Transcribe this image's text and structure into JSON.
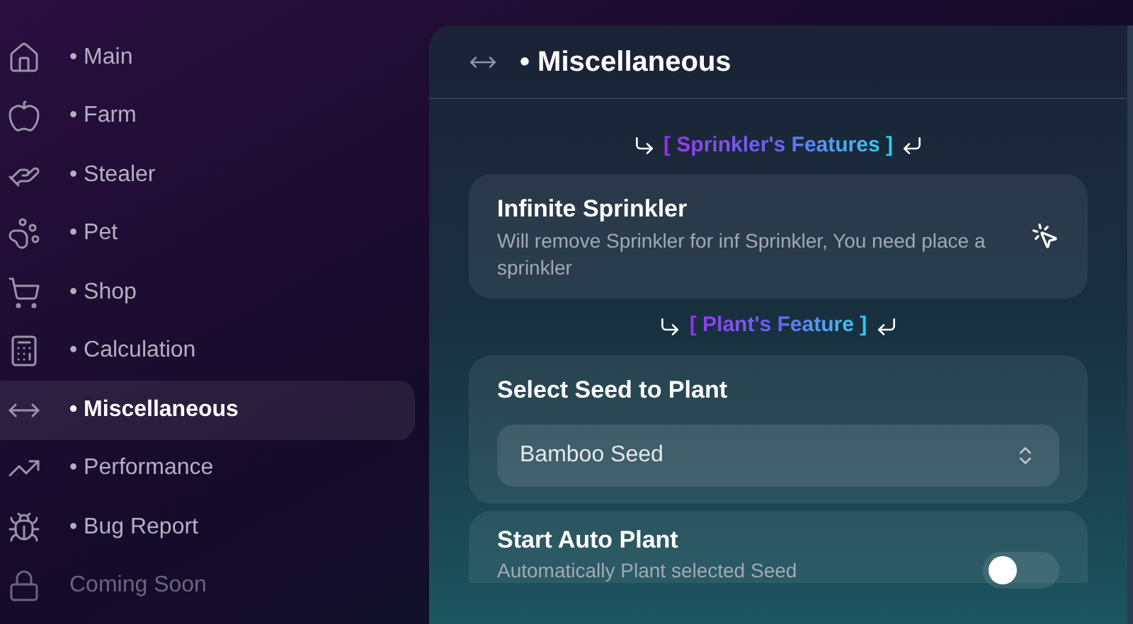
{
  "sidebar": {
    "items": [
      {
        "label": "• Main",
        "selected": false,
        "disabled": false
      },
      {
        "label": "• Farm",
        "selected": false,
        "disabled": false
      },
      {
        "label": "• Stealer",
        "selected": false,
        "disabled": false
      },
      {
        "label": "• Pet",
        "selected": false,
        "disabled": false
      },
      {
        "label": "• Shop",
        "selected": false,
        "disabled": false
      },
      {
        "label": "• Calculation",
        "selected": false,
        "disabled": false
      },
      {
        "label": "• Miscellaneous",
        "selected": true,
        "disabled": false
      },
      {
        "label": "• Performance",
        "selected": false,
        "disabled": false
      },
      {
        "label": "• Bug Report",
        "selected": false,
        "disabled": false
      },
      {
        "label": "Coming Soon",
        "selected": false,
        "disabled": true
      }
    ]
  },
  "panel": {
    "title": "• Miscellaneous",
    "sections": [
      {
        "kind": "heading",
        "text": "[ Sprinkler's Features ]"
      },
      {
        "kind": "button",
        "title": "Infinite Sprinkler",
        "description": "Will remove Sprinkler for inf Sprinkler, You need place a sprinkler"
      },
      {
        "kind": "heading",
        "text": "[ Plant's Feature ]"
      },
      {
        "kind": "dropdown",
        "title": "Select Seed to Plant",
        "value": "Bamboo Seed"
      },
      {
        "kind": "toggle",
        "title": "Start Auto Plant",
        "description": "Automatically Plant selected Seed",
        "on": false
      }
    ]
  }
}
